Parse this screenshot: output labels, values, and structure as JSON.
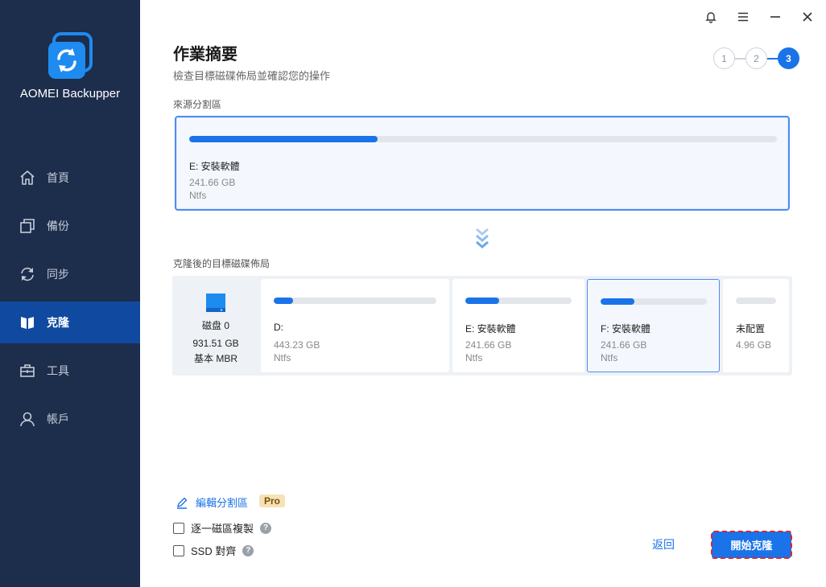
{
  "app": {
    "name": "AOMEI Backupper"
  },
  "sidebar": {
    "items": [
      {
        "label": "首頁",
        "icon": "home-icon"
      },
      {
        "label": "備份",
        "icon": "backup-icon"
      },
      {
        "label": "同步",
        "icon": "sync-icon"
      },
      {
        "label": "克隆",
        "icon": "clone-icon",
        "active": true
      },
      {
        "label": "工具",
        "icon": "tools-icon"
      },
      {
        "label": "帳戶",
        "icon": "account-icon"
      }
    ]
  },
  "header": {
    "title": "作業摘要",
    "subtitle": "檢查目標磁碟佈局並確認您的操作",
    "steps": [
      "1",
      "2",
      "3"
    ],
    "current_step": 3
  },
  "source": {
    "label": "來源分割區",
    "partition": {
      "name": "E: 安裝軟體",
      "size": "241.66 GB",
      "fs": "Ntfs",
      "usage": 0.32
    }
  },
  "destination": {
    "label": "克隆後的目標磁碟佈局",
    "disk": {
      "name": "磁盘 0",
      "size": "931.51 GB",
      "type": "基本 MBR"
    },
    "partitions": [
      {
        "name": "D:",
        "size": "443.23 GB",
        "fs": "Ntfs",
        "usage": 0.12
      },
      {
        "name": "E: 安裝軟體",
        "size": "241.66 GB",
        "fs": "Ntfs",
        "usage": 0.32
      },
      {
        "name": "F: 安裝軟體",
        "size": "241.66 GB",
        "fs": "Ntfs",
        "usage": 0.32,
        "selected": true
      },
      {
        "name": "未配置",
        "size": "4.96 GB",
        "fs": "",
        "usage": 0
      }
    ]
  },
  "options": {
    "edit_partition": "編輯分割區",
    "pro_badge": "Pro",
    "sector_by_sector": "逐一磁區複製",
    "ssd_align": "SSD 對齊",
    "help": "?"
  },
  "buttons": {
    "back": "返回",
    "start": "開始克隆"
  },
  "colors": {
    "sidebar": "#1d2d4c",
    "accent": "#1a73e8",
    "active_nav": "#0f4aa0"
  }
}
